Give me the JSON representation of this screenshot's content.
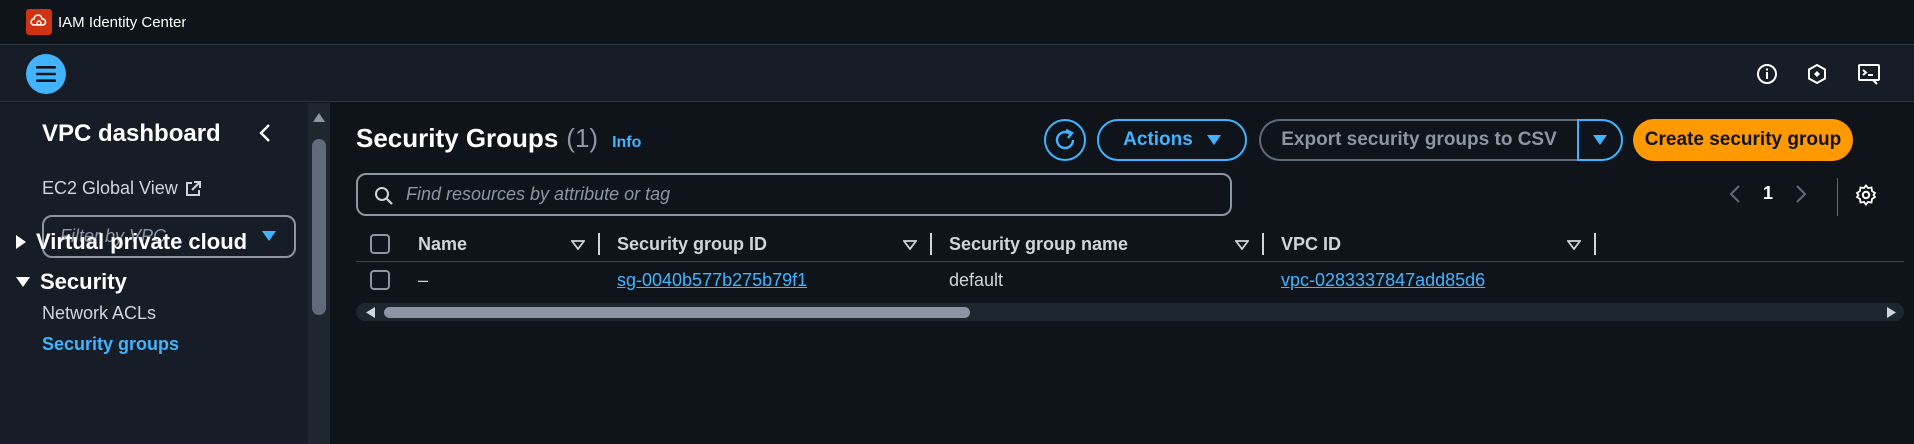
{
  "topbar": {
    "title": "IAM Identity Center",
    "logo_icon": "aws-cloud-logo-icon"
  },
  "header": {
    "icons": [
      "info-circle-icon",
      "notifications-icon",
      "cloudshell-icon"
    ]
  },
  "sidebar": {
    "title": "VPC dashboard",
    "global_view": "EC2 Global View",
    "filter_placeholder": "Filter by VPC",
    "sections": [
      {
        "label": "Virtual private cloud",
        "expanded": false
      },
      {
        "label": "Security",
        "expanded": true
      }
    ],
    "items": [
      {
        "label": "Network ACLs",
        "active": false
      },
      {
        "label": "Security groups",
        "active": true
      }
    ]
  },
  "main": {
    "title": "Security Groups",
    "count": "(1)",
    "info": "Info",
    "actions_label": "Actions",
    "export_label": "Export security groups to CSV",
    "create_label": "Create security group",
    "search_placeholder": "Find resources by attribute or tag",
    "page": "1",
    "columns": [
      "Name",
      "Security group ID",
      "Security group name",
      "VPC ID"
    ],
    "rows": [
      {
        "name": "–",
        "group_id": "sg-0040b577b275b79f1",
        "group_name": "default",
        "vpc_id": "vpc-0283337847add85d6"
      }
    ]
  },
  "colors": {
    "accent": "#42b4ff",
    "primary_button": "#ff9900",
    "background": "#0f141a",
    "panel": "#161d26"
  }
}
